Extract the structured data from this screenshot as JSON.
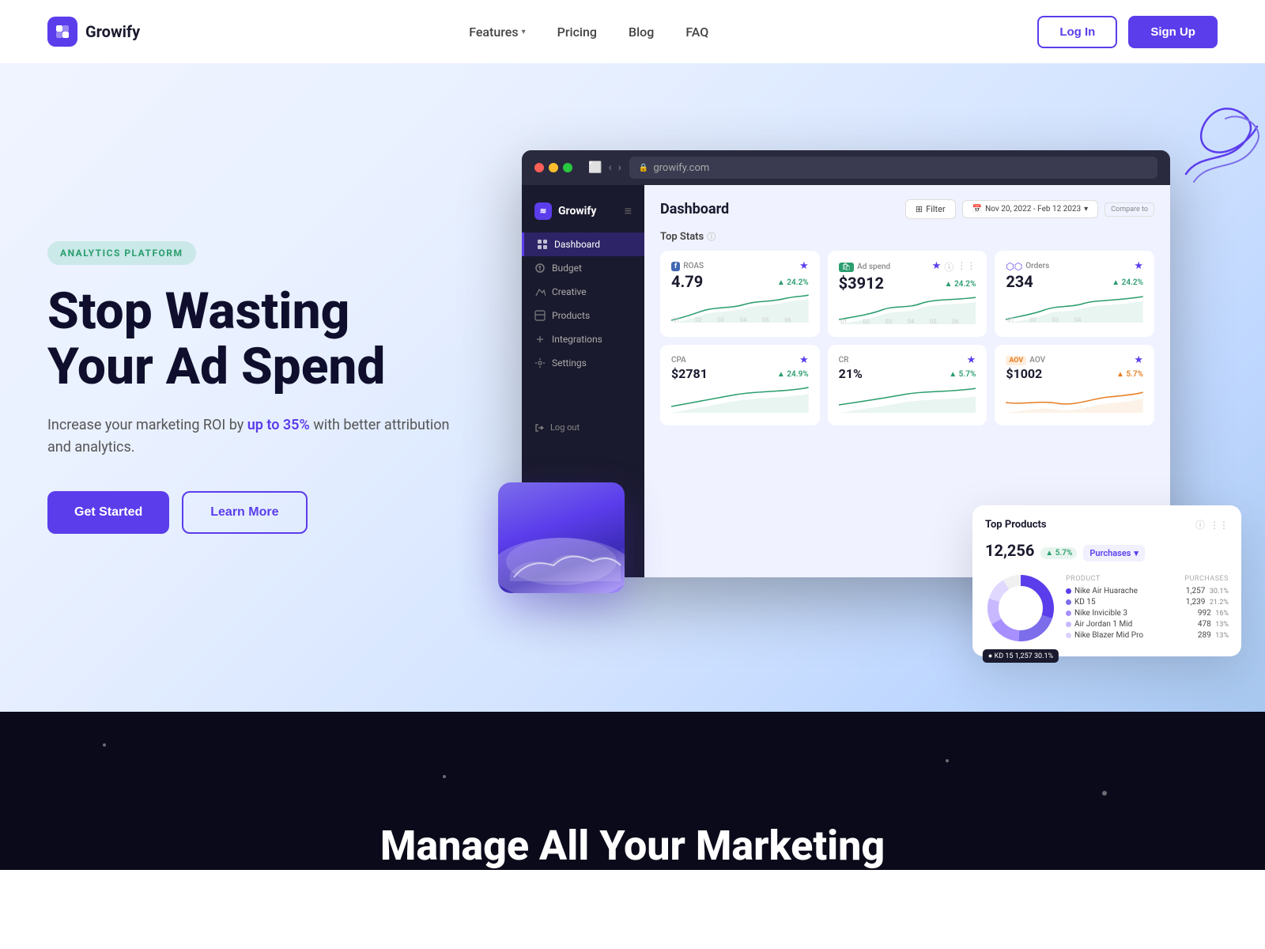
{
  "brand": {
    "name": "Growify",
    "logo_icon": "≋"
  },
  "navbar": {
    "links": [
      {
        "label": "Features",
        "has_dropdown": true
      },
      {
        "label": "Pricing"
      },
      {
        "label": "Blog"
      },
      {
        "label": "FAQ"
      }
    ],
    "login_label": "Log In",
    "signup_label": "Sign Up"
  },
  "hero": {
    "badge": "ANALYTICS PLATFORM",
    "title_line1": "Stop Wasting",
    "title_line2": "Your Ad Spend",
    "subtitle_pre": "Increase your marketing ROI by ",
    "subtitle_highlight": "up to 35%",
    "subtitle_post": " with better attribution and analytics.",
    "cta_primary": "Get Started",
    "cta_secondary": "Learn More"
  },
  "browser": {
    "url": "growify.com",
    "app_name": "Growify"
  },
  "sidebar": {
    "items": [
      {
        "label": "Dashboard",
        "active": true
      },
      {
        "label": "Budget"
      },
      {
        "label": "Creative"
      },
      {
        "label": "Products"
      },
      {
        "label": "Integrations"
      },
      {
        "label": "Settings"
      }
    ],
    "logout_label": "Log out"
  },
  "dashboard": {
    "title": "Dashboard",
    "filter_label": "Filter",
    "date_range": "Nov 20, 2022 - Feb 12 2023",
    "compare_label": "Compare to",
    "top_stats_label": "Top Stats",
    "stats": [
      {
        "label": "ROAS",
        "icon": "F",
        "value": "4.79",
        "change": "24.2%",
        "chart_type": "green_up"
      },
      {
        "label": "Ad spend",
        "icon": "🛍",
        "value": "$3912",
        "change": "24.2%",
        "chart_type": "green_up"
      },
      {
        "label": "Orders",
        "icon": "⬡",
        "value": "234",
        "change": "24.2%",
        "chart_type": "green_up"
      }
    ],
    "stats2": [
      {
        "label": "CPA",
        "value": "$2781",
        "change": "24.9%",
        "chart_type": "green_up"
      },
      {
        "label": "CR",
        "value": "21%",
        "change": "5.7%",
        "chart_type": "green_up"
      },
      {
        "label": "AOV",
        "icon": "AOV",
        "value": "$1002",
        "change": "5.7%",
        "chart_type": "orange_up"
      }
    ]
  },
  "top_products": {
    "title": "Top Products",
    "total": "12,256",
    "total_change": "5.7%",
    "dropdown_label": "Purchases",
    "table_headers": [
      "PRODUCT",
      "PURCHASES"
    ],
    "items": [
      {
        "name": "Nike Air Huarache",
        "value": "1,257",
        "pct": "30.1%",
        "color": "#5b3deb"
      },
      {
        "name": "KD 15",
        "value": "1,239",
        "pct": "21.2%",
        "color": "#7c6deb"
      },
      {
        "name": "Nike Invicible 3",
        "value": "992",
        "pct": "16%",
        "color": "#a78fff"
      },
      {
        "name": "Air Jordan 1 Mid",
        "value": "478",
        "pct": "13%",
        "color": "#c8b8ff"
      },
      {
        "name": "Nike Blazer Mid Pro",
        "value": "289",
        "pct": "13%",
        "color": "#ddd0ff"
      }
    ],
    "tooltip": {
      "label": "KD 15",
      "value": "1,257",
      "pct": "30.1%"
    }
  },
  "bottom": {
    "title": "Manage All Your Marketing"
  }
}
